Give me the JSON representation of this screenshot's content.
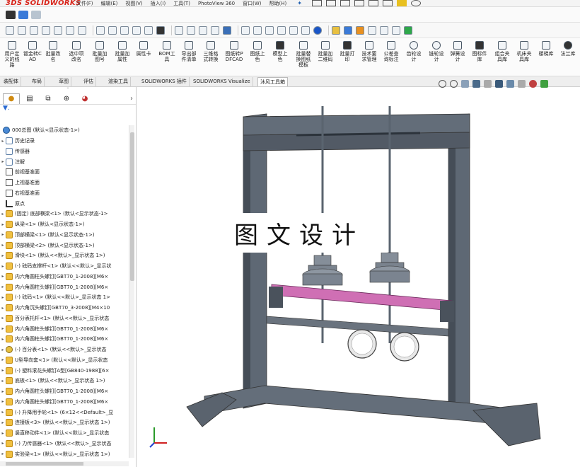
{
  "menubar": {
    "logo": "3DS SOLIDWORKS",
    "items": [
      "文件(F)",
      "编辑(E)",
      "视图(V)",
      "插入(I)",
      "工具(T)",
      "PhotoView 360",
      "窗口(W)",
      "帮助(H)"
    ]
  },
  "ribbon": {
    "buttons": [
      "用户定义的线路",
      "钣金转CAD",
      "批量改名",
      "选中项改名",
      "批量加图号",
      "批量加属性",
      "属性卡",
      "BOM工具",
      "导出部件清单",
      "三维格式转换",
      "图纸转PDFCAD",
      "图纸上色",
      "模型上色",
      "批量替换图纸模板",
      "批量加二维码",
      "批量打印",
      "技术要求管理",
      "公差查询标注",
      "齿轮设计",
      "链轮设计",
      "弹簧设计",
      "图标件库",
      "组合夹具库",
      "机床夹具库",
      "楼梯库",
      "法兰库"
    ]
  },
  "tabs": [
    "装配体",
    "布局",
    "草图",
    "评估",
    "渲染工具",
    "SOLIDWORKS 插件",
    "SOLIDWORKS Visualize",
    "沐风工具箱"
  ],
  "active_tab": "沐风工具箱",
  "tree": {
    "root": "000总图 (默认<显示状态-1>)",
    "items": [
      {
        "label": "历史记录",
        "icon": "folder",
        "arrow": "▸"
      },
      {
        "label": "传感器",
        "icon": "folder",
        "arrow": ""
      },
      {
        "label": "注解",
        "icon": "folder",
        "arrow": "▸"
      },
      {
        "label": "前视基准面",
        "icon": "plane",
        "arrow": ""
      },
      {
        "label": "上视基准面",
        "icon": "plane",
        "arrow": ""
      },
      {
        "label": "右视基准面",
        "icon": "plane",
        "arrow": ""
      },
      {
        "label": "原点",
        "icon": "origin",
        "arrow": ""
      },
      {
        "label": "(固定) 底部横梁<1> (默认<显示状态-1>",
        "icon": "part",
        "arrow": "▸"
      },
      {
        "label": "纵梁<1> (默认<显示状态-1>)",
        "icon": "part",
        "arrow": "▸"
      },
      {
        "label": "顶部横梁<1> (默认<显示状态-1>)",
        "icon": "part",
        "arrow": "▸"
      },
      {
        "label": "顶部横梁<2> (默认<显示状态-1>)",
        "icon": "part",
        "arrow": "▸"
      },
      {
        "label": "滑块<1> (默认<<默认>_显示状态 1>)",
        "icon": "part",
        "arrow": "▸"
      },
      {
        "label": "(-) 砝码支撑杆<1> (默认<<默认>_显示状",
        "icon": "part",
        "arrow": "▸"
      },
      {
        "label": "内六角圆柱头螺钉[GBT70_1-2008][M6×",
        "icon": "part",
        "arrow": "▸"
      },
      {
        "label": "内六角圆柱头螺钉[GBT70_1-2008][M6×",
        "icon": "part",
        "arrow": "▸"
      },
      {
        "label": "(-) 砝码<1> (默认<<默认>_显示状态 1>",
        "icon": "part",
        "arrow": "▸"
      },
      {
        "label": "内六角沉头螺钉[GBT70_3-2008][M4×10",
        "icon": "part",
        "arrow": "▸"
      },
      {
        "label": "百分表托杆<1> (默认<<默认>_显示状态",
        "icon": "part",
        "arrow": "▸"
      },
      {
        "label": "内六角圆柱头螺钉[GBT70_1-2008][M6×",
        "icon": "part",
        "arrow": "▸"
      },
      {
        "label": "内六角圆柱头螺钉[GBT70_1-2008][M6×",
        "icon": "part",
        "arrow": "▸"
      },
      {
        "label": "(-) 百分表<1> (默认<<默认>_显示状态",
        "icon": "asm",
        "arrow": "▸"
      },
      {
        "label": "U型导向套<1> (默认<<默认>_显示状态",
        "icon": "part",
        "arrow": "▸"
      },
      {
        "label": "(-) 塑料滚花头螺钉A型[GB840-1988][6×",
        "icon": "part",
        "arrow": "▸"
      },
      {
        "label": "底板<1> (默认<<默认>_显示状态 1>)",
        "icon": "part",
        "arrow": "▸"
      },
      {
        "label": "内六角圆柱头螺钉[GBT70_1-2008][M6×",
        "icon": "part",
        "arrow": "▸"
      },
      {
        "label": "内六角圆柱头螺钉[GBT70_1-2008][M6×",
        "icon": "part",
        "arrow": "▸"
      },
      {
        "label": "(-) 升降用手轮<1> (6×12<<Default>_显",
        "icon": "part",
        "arrow": "▸"
      },
      {
        "label": "连接板<3> (默认<<默认>_显示状态 1>)",
        "icon": "part",
        "arrow": "▸"
      },
      {
        "label": "竖直移动件<1> (默认<<默认>_显示状态",
        "icon": "part",
        "arrow": "▸"
      },
      {
        "label": "(-) 力传感器<1> (默认<<默认>_显示状态",
        "icon": "part",
        "arrow": "▸"
      },
      {
        "label": "实验梁<1> (默认<<默认>_显示状态 1>)",
        "icon": "part",
        "arrow": "▸"
      }
    ]
  },
  "watermark": "图文设计",
  "colors": {
    "logo": "#d9261c",
    "frame": "#555f6b",
    "beam": "#cf6fb4"
  }
}
